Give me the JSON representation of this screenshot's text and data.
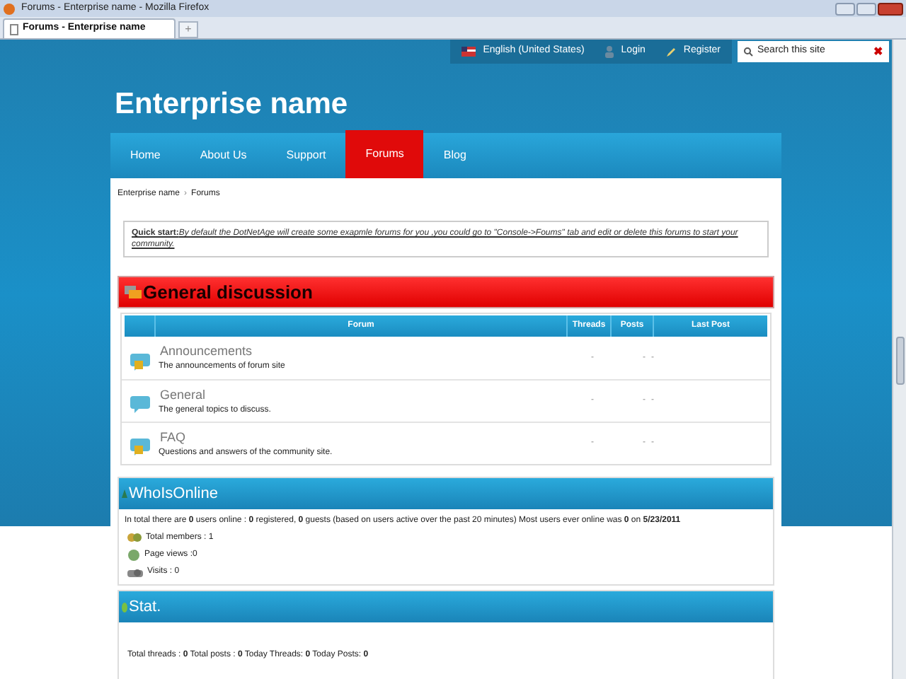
{
  "window": {
    "title": "Forums - Enterprise name - Mozilla Firefox"
  },
  "tabs": [
    {
      "label": "Forums - Enterprise name",
      "selected": true
    }
  ],
  "new_tab": "+",
  "top_links": [
    {
      "label": "English (United States)",
      "kind": "flag"
    },
    {
      "label": "Login",
      "kind": "user"
    },
    {
      "label": "Register",
      "kind": "pen"
    }
  ],
  "search": {
    "placeholder": "Search this site",
    "clear": "✖"
  },
  "site_title": "Enterprise name",
  "nav": [
    {
      "label": "Home",
      "selected": false
    },
    {
      "label": "About Us",
      "selected": false
    },
    {
      "label": "Support",
      "selected": false
    },
    {
      "label": "Forums",
      "selected": true
    },
    {
      "label": "Blog",
      "selected": false
    }
  ],
  "breadcrumb": [
    "Enterprise name",
    "›",
    "Forums"
  ],
  "quick_start": {
    "label": "Quick start:",
    "text": "By default the DotNetAge will create some exapmle forums for you ,you could go to \"Console->Foums\" tab and edit or delete this forums to start your community."
  },
  "category": {
    "title": "General discussion",
    "columns": [
      "Forum",
      "Threads",
      "Posts",
      "Last Post"
    ],
    "forums": [
      {
        "name": "Announcements",
        "description": "The announcements of forum site",
        "threads": "-",
        "posts": "-",
        "last_post": "-",
        "locked": true
      },
      {
        "name": "General",
        "description": "The general topics to discuss.",
        "threads": "-",
        "posts": "-",
        "last_post": "-",
        "locked": false
      },
      {
        "name": "FAQ",
        "description": "Questions and answers of the community site.",
        "threads": "-",
        "posts": "-",
        "last_post": "-",
        "locked": true
      }
    ]
  },
  "who_is_online": {
    "title": "WhoIsOnline",
    "summary": "In total there are **0** users online : **0** registered, **0** guests (based on users active over the past 20 minutes) Most users ever online was **0** on **5/23/2011**",
    "stats": [
      {
        "label": "Total members : 1",
        "kind": "members"
      },
      {
        "label": "Page views :0",
        "kind": "views"
      },
      {
        "label": "Visits : 0",
        "kind": "visits"
      }
    ]
  },
  "stat": {
    "title": "Stat.",
    "text": "Total threads : **0** Total posts : **0** Today Threads: **0** Today Posts: **0**"
  }
}
